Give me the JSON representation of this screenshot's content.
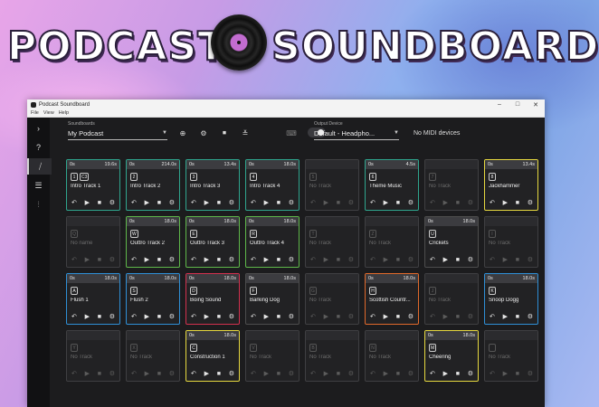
{
  "banner": {
    "left": "PODCAST",
    "right": "SOUNDBOARD"
  },
  "window": {
    "title": "Podcast Soundboard",
    "menu": [
      "File",
      "View",
      "Help"
    ],
    "controls": {
      "minimize": "–",
      "maximize": "□",
      "close": "✕"
    }
  },
  "toolbar": {
    "soundboards_label": "Soundboards",
    "soundboard_value": "My Podcast",
    "output_label": "Output Device",
    "output_value": "Default - Headpho...",
    "midi_status": "No MIDI devices"
  },
  "sidebar": [
    {
      "icon": "›",
      "name": "expand-icon"
    },
    {
      "icon": "?",
      "name": "help-icon"
    },
    {
      "icon": "⧸",
      "name": "soundboard-icon"
    },
    {
      "icon": "☰",
      "name": "list-icon"
    },
    {
      "icon": "⫶",
      "name": "audio-icon"
    }
  ],
  "pads": [
    {
      "time": "0s",
      "dur": "19.6s",
      "keys": [
        "1",
        "C3"
      ],
      "name": "Intro Track 1",
      "color": "#2fa58e"
    },
    {
      "time": "0s",
      "dur": "214.0s",
      "keys": [
        "2"
      ],
      "name": "Intro Track 2",
      "color": "#2fa58e"
    },
    {
      "time": "0s",
      "dur": "13.4s",
      "keys": [
        "3"
      ],
      "name": "Intro Track 3",
      "color": "#2fa58e"
    },
    {
      "time": "0s",
      "dur": "18.0s",
      "keys": [
        "4"
      ],
      "name": "Intro Track 4",
      "color": "#2fa58e"
    },
    {
      "time": "",
      "dur": "",
      "keys": [
        "5"
      ],
      "name": "No Track",
      "color": "",
      "empty": true
    },
    {
      "time": "0s",
      "dur": "4.5s",
      "keys": [
        "6"
      ],
      "name": "Theme Music",
      "color": "#2fa58e"
    },
    {
      "time": "",
      "dur": "",
      "keys": [
        "7"
      ],
      "name": "No Track",
      "color": "",
      "empty": true
    },
    {
      "time": "0s",
      "dur": "13.4s",
      "keys": [
        "8"
      ],
      "name": "Jackhammer",
      "color": "#e6d840"
    },
    {
      "time": "",
      "dur": "",
      "keys": [
        "Q"
      ],
      "name": "No name",
      "color": "",
      "empty": true
    },
    {
      "time": "0s",
      "dur": "18.0s",
      "keys": [
        "W"
      ],
      "name": "Outtro Track 2",
      "color": "#5fb84a"
    },
    {
      "time": "0s",
      "dur": "18.0s",
      "keys": [
        "E"
      ],
      "name": "Outtro Track 3",
      "color": "#5fb84a"
    },
    {
      "time": "0s",
      "dur": "18.0s",
      "keys": [
        "R"
      ],
      "name": "Outtro Track 4",
      "color": "#5fb84a"
    },
    {
      "time": "",
      "dur": "",
      "keys": [
        "T"
      ],
      "name": "No Track",
      "color": "",
      "empty": true
    },
    {
      "time": "",
      "dur": "",
      "keys": [
        "Z"
      ],
      "name": "No Track",
      "color": "",
      "empty": true
    },
    {
      "time": "0s",
      "dur": "18.0s",
      "keys": [
        "U"
      ],
      "name": "Crickets",
      "color": "#4d4d4d"
    },
    {
      "time": "",
      "dur": "",
      "keys": [
        "I"
      ],
      "name": "No Track",
      "color": "",
      "empty": true
    },
    {
      "time": "0s",
      "dur": "18.0s",
      "keys": [
        "A"
      ],
      "name": "Flush 1",
      "color": "#2f8fd6"
    },
    {
      "time": "0s",
      "dur": "18.0s",
      "keys": [
        "S"
      ],
      "name": "Flush 2",
      "color": "#2f8fd6"
    },
    {
      "time": "0s",
      "dur": "18.0s",
      "keys": [
        "D"
      ],
      "name": "Boing Sound",
      "color": "#d2314f"
    },
    {
      "time": "0s",
      "dur": "18.0s",
      "keys": [
        "F"
      ],
      "name": "Barking Dog",
      "color": "#4d4d4d"
    },
    {
      "time": "",
      "dur": "",
      "keys": [
        "G"
      ],
      "name": "No Track",
      "color": "",
      "empty": true
    },
    {
      "time": "0s",
      "dur": "18.0s",
      "keys": [
        "H"
      ],
      "name": "Scottish Countr...",
      "color": "#e0692b"
    },
    {
      "time": "",
      "dur": "",
      "keys": [
        "J"
      ],
      "name": "No Track",
      "color": "",
      "empty": true
    },
    {
      "time": "0s",
      "dur": "18.0s",
      "keys": [
        "K"
      ],
      "name": "Snoop Dogg",
      "color": "#2f8fd6"
    },
    {
      "time": "",
      "dur": "",
      "keys": [
        "Y"
      ],
      "name": "No Track",
      "color": "",
      "empty": true
    },
    {
      "time": "",
      "dur": "",
      "keys": [
        "X"
      ],
      "name": "No Track",
      "color": "",
      "empty": true
    },
    {
      "time": "0s",
      "dur": "18.0s",
      "keys": [
        "C"
      ],
      "name": "Construction 1",
      "color": "#e6d840"
    },
    {
      "time": "",
      "dur": "",
      "keys": [
        "V"
      ],
      "name": "No Track",
      "color": "",
      "empty": true
    },
    {
      "time": "",
      "dur": "",
      "keys": [
        "B"
      ],
      "name": "No Track",
      "color": "",
      "empty": true
    },
    {
      "time": "",
      "dur": "",
      "keys": [
        "N"
      ],
      "name": "No Track",
      "color": "",
      "empty": true
    },
    {
      "time": "0s",
      "dur": "18.0s",
      "keys": [
        "M"
      ],
      "name": "Cheering",
      "color": "#e6d840"
    },
    {
      "time": "",
      "dur": "",
      "keys": [
        ""
      ],
      "name": "No Track",
      "color": "",
      "empty": true
    }
  ],
  "pad_icons": {
    "loop": "↶",
    "play": "▶",
    "stop": "■",
    "settings": "⚙"
  }
}
